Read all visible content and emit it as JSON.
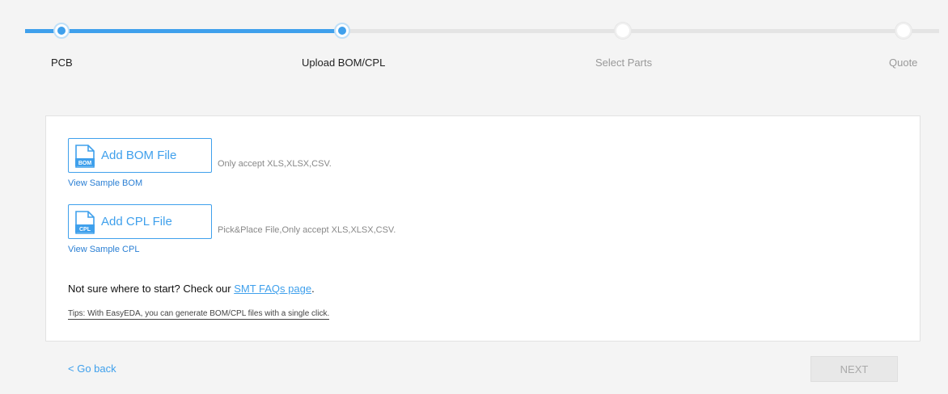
{
  "stepper": {
    "steps": [
      {
        "label": "PCB",
        "state": "done"
      },
      {
        "label": "Upload BOM/CPL",
        "state": "active"
      },
      {
        "label": "Select Parts",
        "state": "pending"
      },
      {
        "label": "Quote",
        "state": "pending"
      }
    ],
    "accent_color": "#3fa0ec"
  },
  "bom": {
    "button_label": "Add BOM File",
    "icon_text": "BOM",
    "hint": "Only accept XLS,XLSX,CSV.",
    "sample_link": "View Sample BOM"
  },
  "cpl": {
    "button_label": "Add CPL File",
    "icon_text": "CPL",
    "hint": "Pick&Place File,Only accept XLS,XLSX,CSV.",
    "sample_link": "View Sample CPL"
  },
  "help": {
    "prefix": "Not sure where to start? Check our ",
    "link_text": "SMT FAQs page",
    "suffix": "."
  },
  "tips": "Tips: With EasyEDA, you can generate BOM/CPL files with a single click.",
  "footer": {
    "back_label": "< Go back",
    "next_label": "NEXT"
  }
}
